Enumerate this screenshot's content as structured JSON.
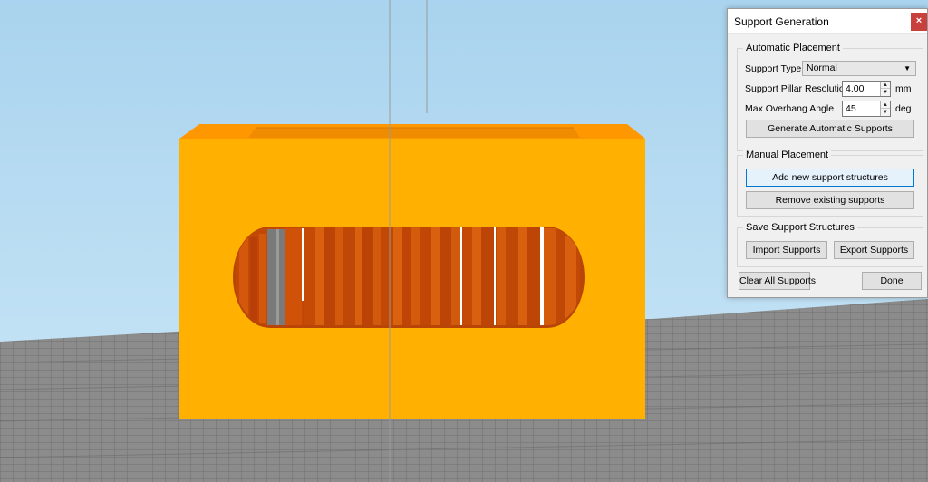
{
  "dialog": {
    "title": "Support Generation",
    "close_label": "×",
    "automatic": {
      "group_label": "Automatic Placement",
      "support_type_label": "Support Type",
      "support_type_value": "Normal",
      "pillar_resolution_label": "Support Pillar Resolution",
      "pillar_resolution_value": "4.00",
      "pillar_resolution_unit": "mm",
      "overhang_label": "Max Overhang Angle",
      "overhang_value": "45",
      "overhang_unit": "deg",
      "generate_button": "Generate Automatic Supports"
    },
    "manual": {
      "group_label": "Manual Placement",
      "add_button": "Add new support structures",
      "remove_button": "Remove existing supports"
    },
    "save": {
      "group_label": "Save Support Structures",
      "import_button": "Import Supports",
      "export_button": "Export Supports"
    },
    "clear_all_button": "Clear All Supports",
    "done_button": "Done"
  },
  "colors": {
    "sky_top": "#aed6ee",
    "sky_bottom": "#c9e6f6",
    "model_front": "#ffb000",
    "model_top": "#ff9800",
    "support_orange": "#c94a06",
    "support_gray": "#7a7a7a",
    "floor": "#8a8a8a",
    "dialog_bg": "#f0f0f0",
    "close_red": "#c8413c",
    "focus_blue": "#0078d7"
  }
}
